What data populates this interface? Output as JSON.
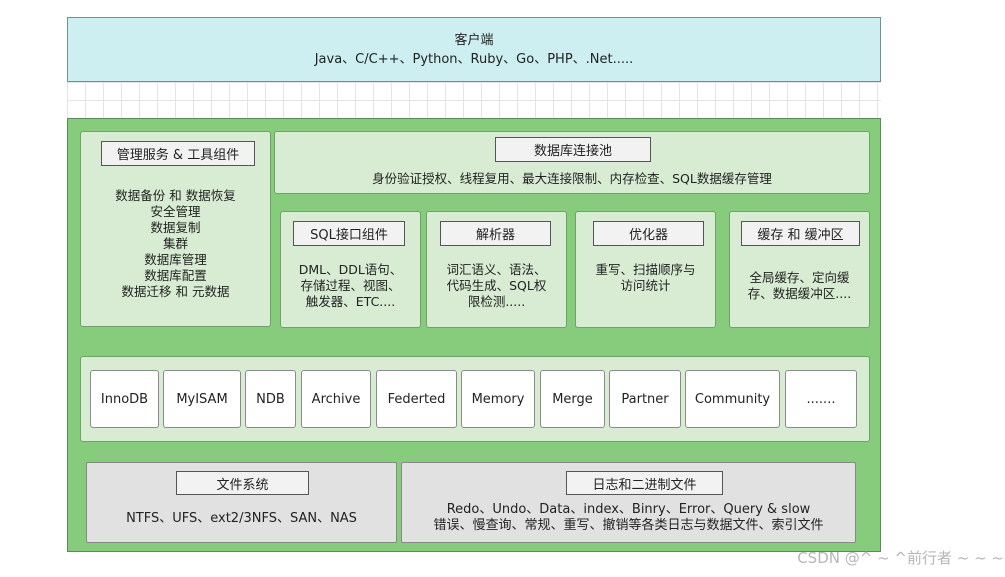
{
  "client": {
    "title": "客户端",
    "langs": "Java、C/C++、Python、Ruby、Go、PHP、.Net....."
  },
  "management": {
    "label": "管理服务 & 工具组件",
    "items": [
      "数据备份 和 数据恢复",
      "安全管理",
      "数据复制",
      "集群",
      "数据库管理",
      "数据库配置",
      "数据迁移 和 元数据"
    ]
  },
  "pool": {
    "label": "数据库连接池",
    "text": "身份验证授权、线程复用、最大连接限制、内存检查、SQL数据缓存管理"
  },
  "sql_interface": {
    "label": "SQL接口组件",
    "lines": [
      "DML、DDL语句、",
      "存储过程、视图、",
      "触发器、ETC...."
    ]
  },
  "parser": {
    "label": "解析器",
    "lines": [
      "词汇语义、语法、",
      "代码生成、SQL权",
      "限检测....."
    ]
  },
  "optimizer": {
    "label": "优化器",
    "lines": [
      "重写、扫描顺序与",
      "访问统计"
    ]
  },
  "cache": {
    "label": "缓存 和 缓冲区",
    "lines": [
      "全局缓存、定向缓",
      "存、数据缓冲区...."
    ]
  },
  "engines": [
    "InnoDB",
    "MyISAM",
    "NDB",
    "Archive",
    "Federted",
    "Memory",
    "Merge",
    "Partner",
    "Community",
    "......."
  ],
  "filesystem": {
    "label": "文件系统",
    "text": "NTFS、UFS、ext2/3NFS、SAN、NAS"
  },
  "logs": {
    "label": "日志和二进制文件",
    "lines": [
      "Redo、Undo、Data、index、Binry、Error、Query & slow",
      "错误、慢查询、常规、重写、撤销等各类日志与数据文件、索引文件"
    ]
  },
  "watermark": "CSDN @^ ~ ^前行者 ~ ~ ~"
}
